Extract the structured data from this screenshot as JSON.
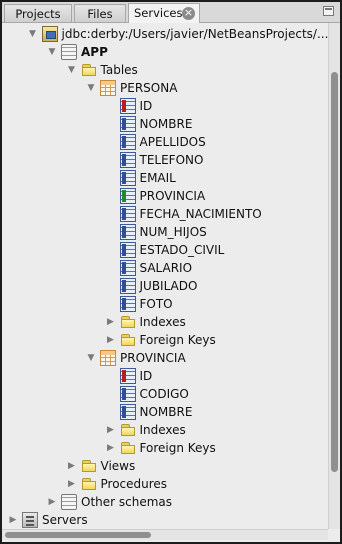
{
  "tabs": [
    {
      "label": "Projects",
      "active": false
    },
    {
      "label": "Files",
      "active": false
    },
    {
      "label": "Services",
      "active": true
    }
  ],
  "tree": [
    {
      "label": "jdbc:derby:/Users/javier/NetBeansProjects/...",
      "icon": "database-connection-icon",
      "toggle": "expanded",
      "depth": 1,
      "bold": false
    },
    {
      "label": "APP",
      "icon": "schema-icon",
      "toggle": "expanded",
      "depth": 2,
      "bold": true
    },
    {
      "label": "Tables",
      "icon": "folder-icon",
      "toggle": "expanded",
      "depth": 3,
      "bold": false
    },
    {
      "label": "PERSONA",
      "icon": "table-icon",
      "toggle": "expanded",
      "depth": 4,
      "bold": false
    },
    {
      "label": "ID",
      "icon": "primary-key-column-icon",
      "toggle": "none",
      "depth": 5,
      "bold": false
    },
    {
      "label": "NOMBRE",
      "icon": "column-icon",
      "toggle": "none",
      "depth": 5,
      "bold": false
    },
    {
      "label": "APELLIDOS",
      "icon": "column-icon",
      "toggle": "none",
      "depth": 5,
      "bold": false
    },
    {
      "label": "TELEFONO",
      "icon": "column-icon",
      "toggle": "none",
      "depth": 5,
      "bold": false
    },
    {
      "label": "EMAIL",
      "icon": "column-icon",
      "toggle": "none",
      "depth": 5,
      "bold": false
    },
    {
      "label": "PROVINCIA",
      "icon": "foreign-key-column-icon",
      "toggle": "none",
      "depth": 5,
      "bold": false
    },
    {
      "label": "FECHA_NACIMIENTO",
      "icon": "column-icon",
      "toggle": "none",
      "depth": 5,
      "bold": false
    },
    {
      "label": "NUM_HIJOS",
      "icon": "column-icon",
      "toggle": "none",
      "depth": 5,
      "bold": false
    },
    {
      "label": "ESTADO_CIVIL",
      "icon": "column-icon",
      "toggle": "none",
      "depth": 5,
      "bold": false
    },
    {
      "label": "SALARIO",
      "icon": "column-icon",
      "toggle": "none",
      "depth": 5,
      "bold": false
    },
    {
      "label": "JUBILADO",
      "icon": "column-icon",
      "toggle": "none",
      "depth": 5,
      "bold": false
    },
    {
      "label": "FOTO",
      "icon": "column-icon",
      "toggle": "none",
      "depth": 5,
      "bold": false
    },
    {
      "label": "Indexes",
      "icon": "folder-icon",
      "toggle": "collapsed",
      "depth": 5,
      "bold": false
    },
    {
      "label": "Foreign Keys",
      "icon": "folder-icon",
      "toggle": "collapsed",
      "depth": 5,
      "bold": false
    },
    {
      "label": "PROVINCIA",
      "icon": "table-icon",
      "toggle": "expanded",
      "depth": 4,
      "bold": false
    },
    {
      "label": "ID",
      "icon": "primary-key-column-icon",
      "toggle": "none",
      "depth": 5,
      "bold": false
    },
    {
      "label": "CODIGO",
      "icon": "column-icon",
      "toggle": "none",
      "depth": 5,
      "bold": false
    },
    {
      "label": "NOMBRE",
      "icon": "column-icon",
      "toggle": "none",
      "depth": 5,
      "bold": false
    },
    {
      "label": "Indexes",
      "icon": "folder-icon",
      "toggle": "collapsed",
      "depth": 5,
      "bold": false
    },
    {
      "label": "Foreign Keys",
      "icon": "folder-icon",
      "toggle": "collapsed",
      "depth": 5,
      "bold": false
    },
    {
      "label": "Views",
      "icon": "folder-icon",
      "toggle": "collapsed",
      "depth": 3,
      "bold": false
    },
    {
      "label": "Procedures",
      "icon": "folder-icon",
      "toggle": "collapsed",
      "depth": 3,
      "bold": false
    },
    {
      "label": "Other schemas",
      "icon": "schema-icon",
      "toggle": "collapsed",
      "depth": 2,
      "bold": false
    },
    {
      "label": "Servers",
      "icon": "servers-icon",
      "toggle": "collapsed",
      "depth": 0,
      "bold": false
    }
  ]
}
